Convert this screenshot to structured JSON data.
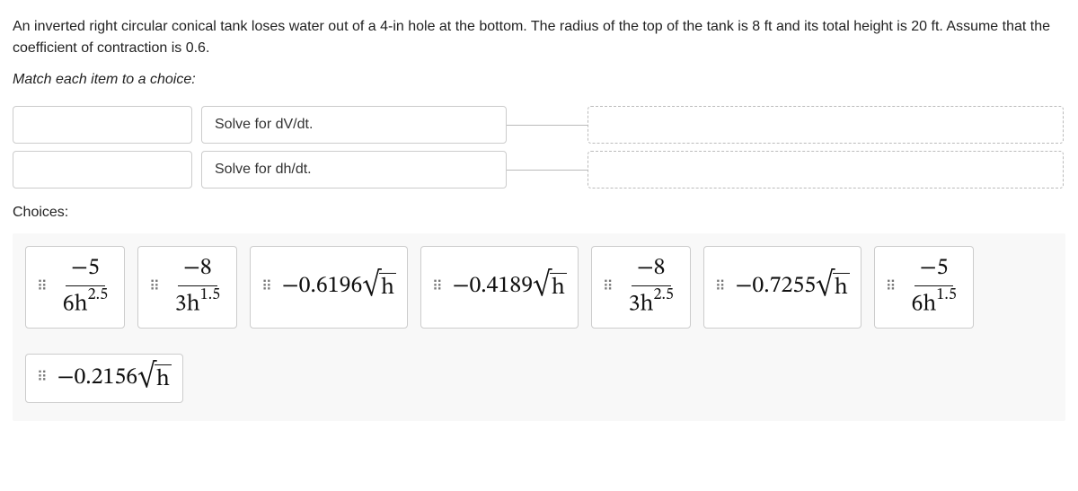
{
  "problem": {
    "text": "An inverted right circular conical tank loses water out of a 4-in hole at the bottom. The radius of the top of the tank is 8 ft and its total height is 20 ft. Assume that the coefficient of contraction is 0.6.",
    "instruction": "Match each item to a choice:"
  },
  "matches": [
    {
      "label": "Solve for dV/dt."
    },
    {
      "label": "Solve for dh/dt."
    }
  ],
  "choices_label": "Choices:",
  "choices": [
    {
      "type": "frac",
      "num_minus": "−5",
      "den_coef": "6",
      "den_var": "h",
      "den_exp": "2.5"
    },
    {
      "type": "frac",
      "num_minus": "−8",
      "den_coef": "3",
      "den_var": "h",
      "den_exp": "1.5"
    },
    {
      "type": "sqrt",
      "coef": "−0.6196",
      "radicand": "h"
    },
    {
      "type": "sqrt",
      "coef": "−0.4189",
      "radicand": "h"
    },
    {
      "type": "frac",
      "num_minus": "−8",
      "den_coef": "3",
      "den_var": "h",
      "den_exp": "2.5"
    },
    {
      "type": "sqrt",
      "coef": "−0.7255",
      "radicand": "h"
    },
    {
      "type": "frac",
      "num_minus": "−5",
      "den_coef": "6",
      "den_var": "h",
      "den_exp": "1.5"
    },
    {
      "type": "sqrt",
      "coef": "−0.2156",
      "radicand": "h"
    }
  ]
}
